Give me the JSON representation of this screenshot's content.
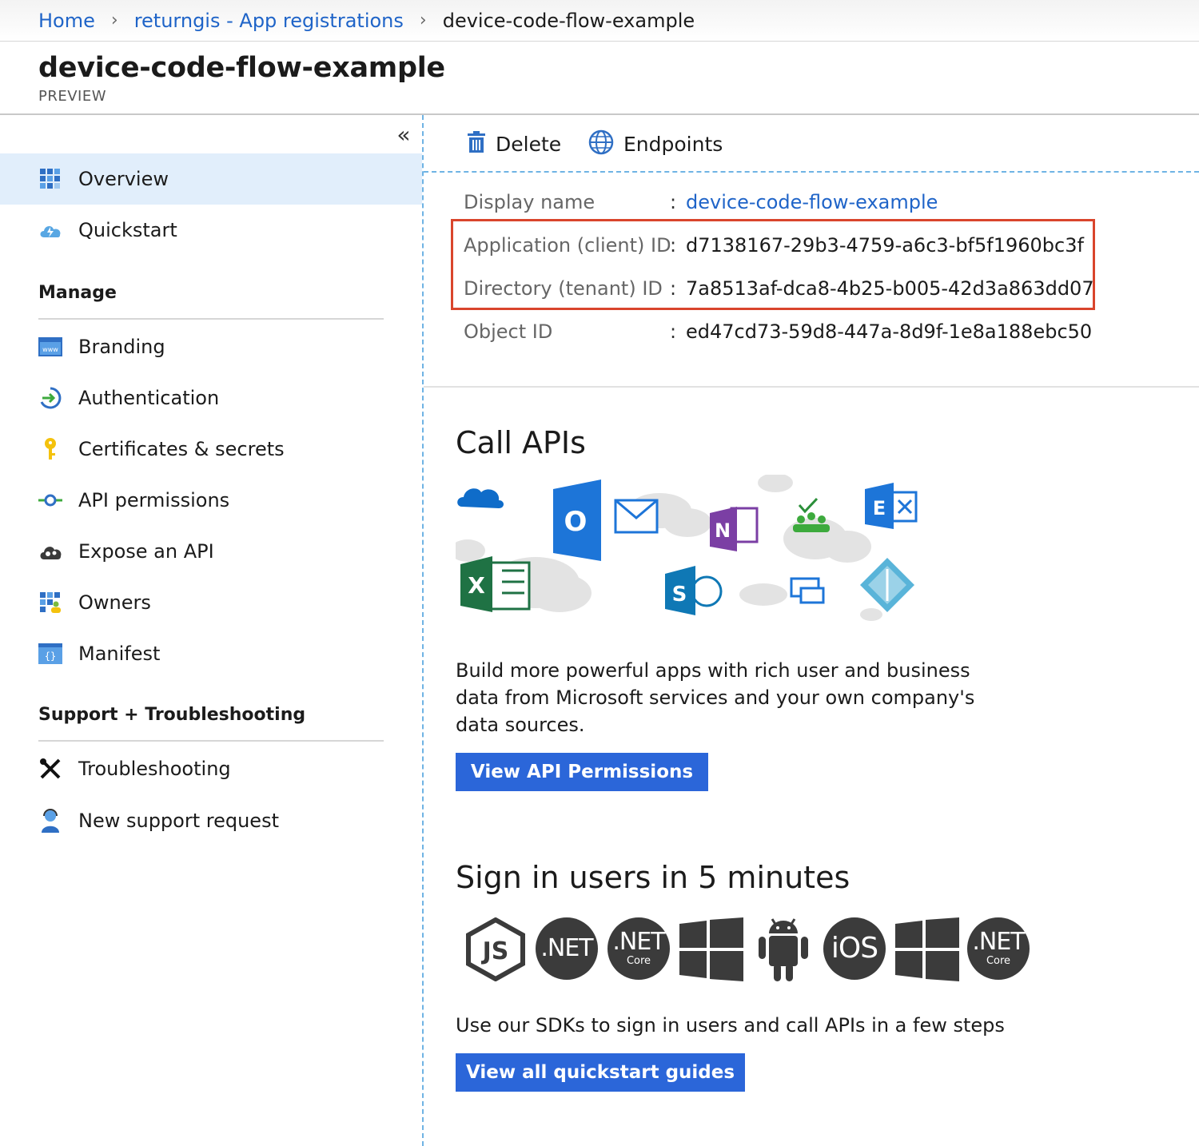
{
  "breadcrumb": {
    "home": "Home",
    "parent": "returngis - App registrations",
    "current": "device-code-flow-example"
  },
  "header": {
    "title": "device-code-flow-example",
    "subtitle": "PREVIEW"
  },
  "sidebar": {
    "collapse_glyph": "«",
    "items_top": [
      {
        "label": "Overview",
        "icon": "overview-grid-icon",
        "active": true
      },
      {
        "label": "Quickstart",
        "icon": "cloud-lightning-icon",
        "active": false
      }
    ],
    "manage_label": "Manage",
    "manage_items": [
      {
        "label": "Branding",
        "icon": "www-window-icon"
      },
      {
        "label": "Authentication",
        "icon": "sign-in-arrow-icon"
      },
      {
        "label": "Certificates & secrets",
        "icon": "key-icon"
      },
      {
        "label": "API permissions",
        "icon": "api-connector-icon"
      },
      {
        "label": "Expose an API",
        "icon": "cloud-gears-icon"
      },
      {
        "label": "Owners",
        "icon": "owners-grid-icon"
      },
      {
        "label": "Manifest",
        "icon": "braces-window-icon"
      }
    ],
    "support_label": "Support + Troubleshooting",
    "support_items": [
      {
        "label": "Troubleshooting",
        "icon": "wrench-screwdriver-icon"
      },
      {
        "label": "New support request",
        "icon": "support-person-icon"
      }
    ]
  },
  "toolbar": {
    "delete_label": "Delete",
    "endpoints_label": "Endpoints"
  },
  "essentials": {
    "display_name_key": "Display name",
    "display_name_value": "device-code-flow-example",
    "app_id_key": "Application (client) ID",
    "app_id_value": "d7138167-29b3-4759-a6c3-bf5f1960bc3f",
    "tenant_id_key": "Directory (tenant) ID",
    "tenant_id_value": "7a8513af-dca8-4b25-b005-42d3a863dd07",
    "object_id_key": "Object ID",
    "object_id_value": "ed47cd73-59d8-447a-8d9f-1e8a188ebc50",
    "colon": ":"
  },
  "call_apis": {
    "heading": "Call APIs",
    "description": "Build more powerful apps with rich user and business data from Microsoft services and your own company's data sources.",
    "button_label": "View API Permissions",
    "logo_letters": {
      "outlook": "O",
      "onenote": "N",
      "excel": "X",
      "sharepoint": "S",
      "exchange": "E"
    }
  },
  "sign_in": {
    "heading": "Sign in users in 5 minutes",
    "description": "Use our SDKs to sign in users and call APIs in a few steps",
    "button_label": "View all quickstart guides",
    "sdk_labels": {
      "nodejs": "JS",
      "dotnet": ".NET",
      "dotnet_core": ".NET",
      "core_sub": "Core",
      "ios": "iOS"
    }
  },
  "colors": {
    "link_blue": "#1f64c8",
    "button_blue": "#2b66d9",
    "highlight_red": "#d9452c",
    "active_bg": "#e1eefb"
  }
}
